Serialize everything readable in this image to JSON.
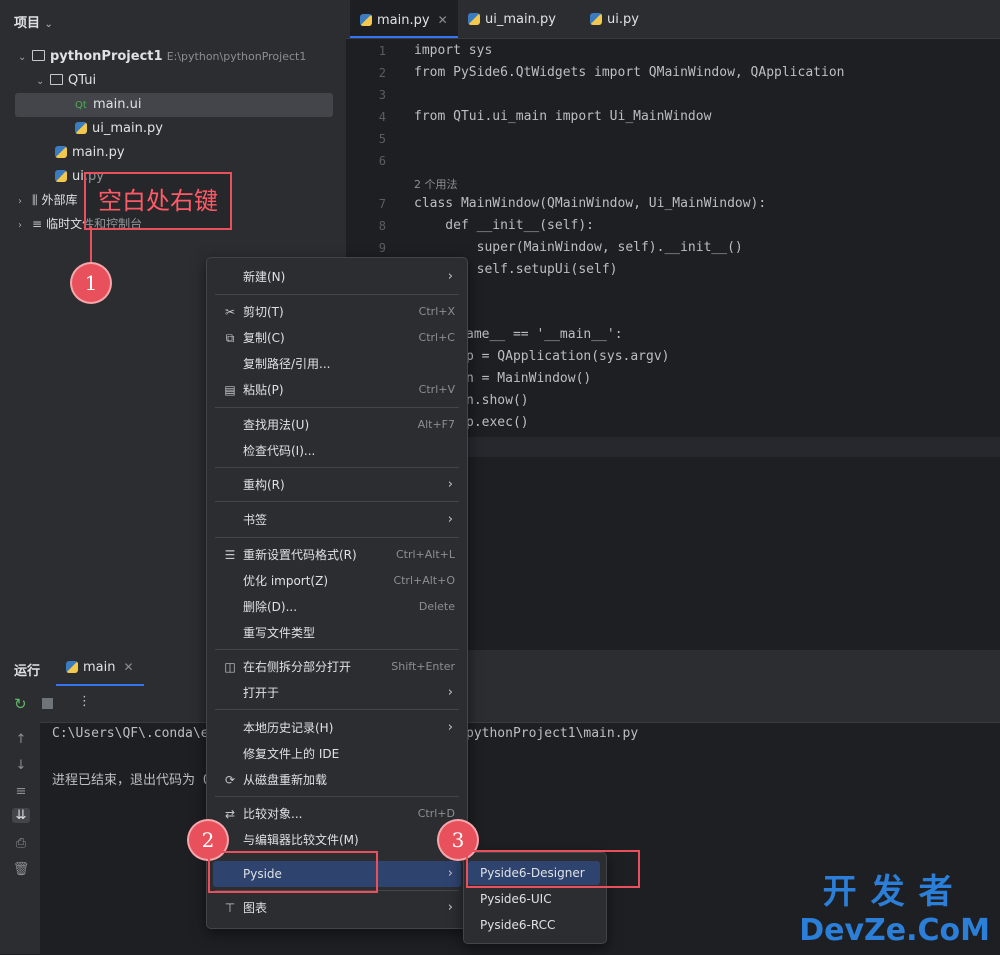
{
  "project": {
    "header": "项目",
    "tree": [
      {
        "label": "pythonProject1",
        "path": "E:\\python\\pythonProject1"
      },
      {
        "label": "QTui"
      },
      {
        "label": "main.ui"
      },
      {
        "label": "ui_main.py"
      },
      {
        "label": "main.py"
      },
      {
        "label": "ui.py"
      },
      {
        "label": "外部库"
      },
      {
        "label": "临时文件和控制台"
      }
    ]
  },
  "editor": {
    "tabs": [
      {
        "label": "main.py"
      },
      {
        "label": "ui_main.py"
      },
      {
        "label": "ui.py"
      }
    ],
    "line_numbers": [
      "1",
      "2",
      "3",
      "4",
      "5",
      "6",
      "7",
      "8",
      "9"
    ],
    "usage_hint": "2 个用法",
    "code": {
      "l1": "import sys",
      "l2": "from PySide6.QtWidgets import QMainWindow, QApplication",
      "l4": "from QTui.ui_main import Ui_MainWindow",
      "l7": "class MainWindow(QMainWindow, Ui_MainWindow):",
      "l8": "    def __init__(self):",
      "l9": "        super(MainWindow, self).__init__()",
      "l10": "        self.setupUi(self)",
      "l13": "ame__ == '__main__':",
      "l14": "p = QApplication(sys.argv)",
      "l15": "n = MainWindow()",
      "l16": "n.show()",
      "l17": "p.exec()"
    }
  },
  "run": {
    "label": "运行",
    "tab": "main",
    "console_line1_left": "C:\\Users\\QF\\.conda\\e",
    "console_line1_right": "pythonProject1\\main.py",
    "console_line2": "进程已结束，退出代码为 0"
  },
  "context_menu": {
    "items": [
      {
        "label": "新建(N)",
        "shortcut": "",
        "icon": ""
      },
      {
        "label": "剪切(T)",
        "shortcut": "Ctrl+X",
        "icon": "scissors-icon"
      },
      {
        "label": "复制(C)",
        "shortcut": "Ctrl+C",
        "icon": "copy-icon"
      },
      {
        "label": "复制路径/引用...",
        "shortcut": "",
        "icon": ""
      },
      {
        "label": "粘贴(P)",
        "shortcut": "Ctrl+V",
        "icon": "paste-icon"
      },
      {
        "label": "查找用法(U)",
        "shortcut": "Alt+F7",
        "icon": ""
      },
      {
        "label": "检查代码(I)...",
        "shortcut": "",
        "icon": ""
      },
      {
        "label": "重构(R)",
        "shortcut": "",
        "icon": ""
      },
      {
        "label": "书签",
        "shortcut": "",
        "icon": ""
      },
      {
        "label": "重新设置代码格式(R)",
        "shortcut": "Ctrl+Alt+L",
        "icon": "format-icon"
      },
      {
        "label": "优化 import(Z)",
        "shortcut": "Ctrl+Alt+O",
        "icon": ""
      },
      {
        "label": "删除(D)...",
        "shortcut": "Delete",
        "icon": ""
      },
      {
        "label": "重写文件类型",
        "shortcut": "",
        "icon": ""
      },
      {
        "label": "在右侧拆分部分打开",
        "shortcut": "Shift+Enter",
        "icon": "split-icon"
      },
      {
        "label": "打开于",
        "shortcut": "",
        "icon": ""
      },
      {
        "label": "本地历史记录(H)",
        "shortcut": "",
        "icon": ""
      },
      {
        "label": "修复文件上的 IDE",
        "shortcut": "",
        "icon": ""
      },
      {
        "label": "从磁盘重新加载",
        "shortcut": "",
        "icon": "reload-icon"
      },
      {
        "label": "比较对象...",
        "shortcut": "Ctrl+D",
        "icon": "compare-icon"
      },
      {
        "label": "与编辑器比较文件(M)",
        "shortcut": "",
        "icon": ""
      },
      {
        "label": "Pyside",
        "shortcut": "",
        "icon": ""
      },
      {
        "label": "图表",
        "shortcut": "",
        "icon": "diagram-icon"
      }
    ]
  },
  "submenu": {
    "items": [
      "Pyside6-Designer",
      "Pyside6-UIC",
      "Pyside6-RCC"
    ]
  },
  "annotations": {
    "callout": "空白处右键",
    "badges": [
      "1",
      "2",
      "3"
    ],
    "accent": "#e8505b"
  },
  "watermark": {
    "line1": "开发者",
    "line2": "DevZe.CoM"
  }
}
